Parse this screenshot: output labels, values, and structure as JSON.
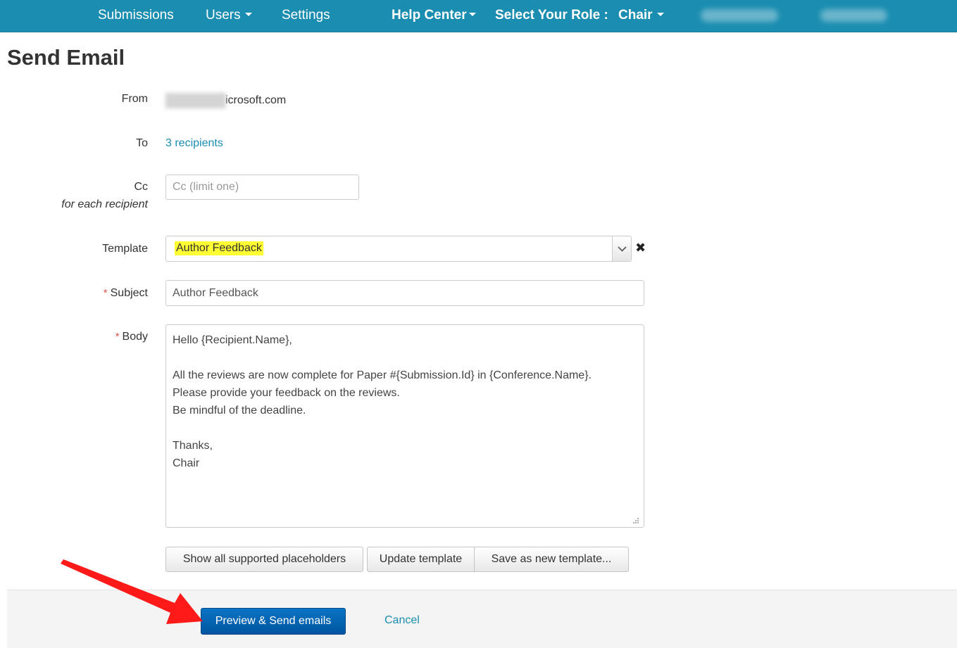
{
  "nav": {
    "submissions": "Submissions",
    "users": "Users",
    "settings": "Settings",
    "help_center": "Help Center",
    "role_label": "Select Your Role :",
    "role_value": "Chair"
  },
  "page": {
    "title": "Send Email"
  },
  "form": {
    "from_label": "From",
    "from_value_visible": "icrosoft.com",
    "to_label": "To",
    "to_value": "3 recipients",
    "cc_label": "Cc",
    "cc_sublabel": "for each recipient",
    "cc_placeholder": "Cc (limit one)",
    "template_label": "Template",
    "template_value": "Author Feedback",
    "subject_label": "Subject",
    "subject_value": "Author Feedback",
    "body_label": "Body",
    "body_value": "Hello {Recipient.Name},\n\nAll the reviews are now complete for Paper #{Submission.Id} in {Conference.Name}.\nPlease provide your feedback on the reviews.\nBe mindful of the deadline.\n\nThanks,\nChair",
    "required_marker": "*"
  },
  "buttons": {
    "show_placeholders": "Show all supported placeholders",
    "update_template": "Update template",
    "save_new_template": "Save as new template...",
    "preview_send": "Preview & Send emails",
    "cancel": "Cancel"
  },
  "icons": {
    "caret": "caret-down-icon",
    "select_arrow": "chevron-down-icon",
    "clear": "close-icon",
    "resize": "resize-grip-icon",
    "annotation": "red-arrow-icon"
  },
  "colors": {
    "navbar": "#1a8db0",
    "link": "#1a8db0",
    "highlight": "#ffff33",
    "primary_button": "#0a6bbd",
    "required": "#d9534f",
    "annotation_arrow": "#ff1a1a"
  }
}
